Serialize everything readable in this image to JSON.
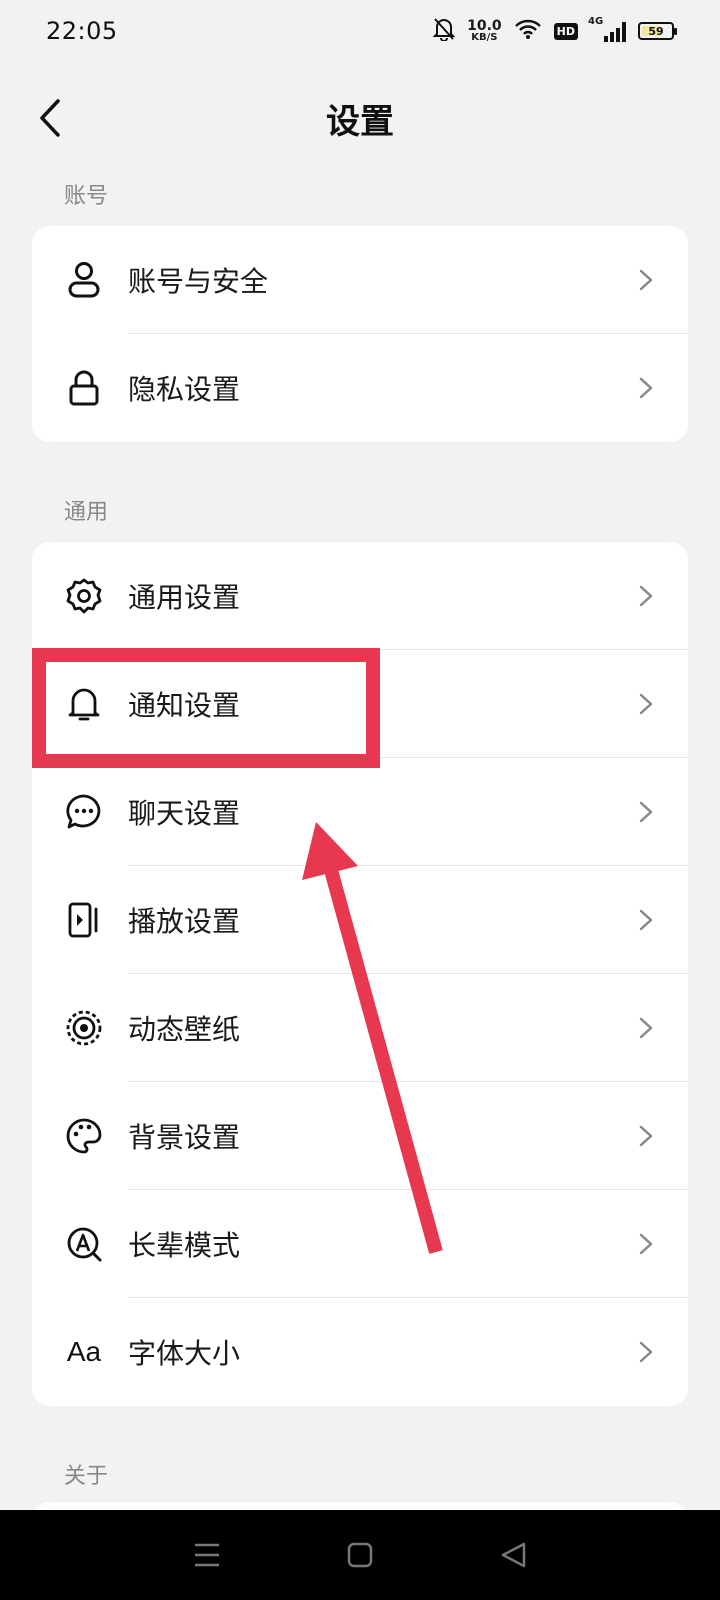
{
  "status_bar": {
    "time": "22:05",
    "net_speed_value": "10.0",
    "net_speed_unit": "KB/S",
    "hd": "HD",
    "network": "4G",
    "battery": "59"
  },
  "header": {
    "title": "设置"
  },
  "sections": {
    "account": {
      "label": "账号",
      "items": [
        {
          "label": "账号与安全",
          "icon": "user-icon"
        },
        {
          "label": "隐私设置",
          "icon": "lock-icon"
        }
      ]
    },
    "general": {
      "label": "通用",
      "items": [
        {
          "label": "通用设置",
          "icon": "gear-icon"
        },
        {
          "label": "通知设置",
          "icon": "bell-icon"
        },
        {
          "label": "聊天设置",
          "icon": "chat-bubble-icon"
        },
        {
          "label": "播放设置",
          "icon": "playback-icon"
        },
        {
          "label": "动态壁纸",
          "icon": "live-wallpaper-icon"
        },
        {
          "label": "背景设置",
          "icon": "palette-icon"
        },
        {
          "label": "长辈模式",
          "icon": "elder-mode-icon"
        },
        {
          "label": "字体大小",
          "icon": "font-size-icon",
          "glyph": "Aa"
        }
      ]
    },
    "about": {
      "label": "关于"
    }
  },
  "annotation": {
    "color": "#e8384f"
  }
}
